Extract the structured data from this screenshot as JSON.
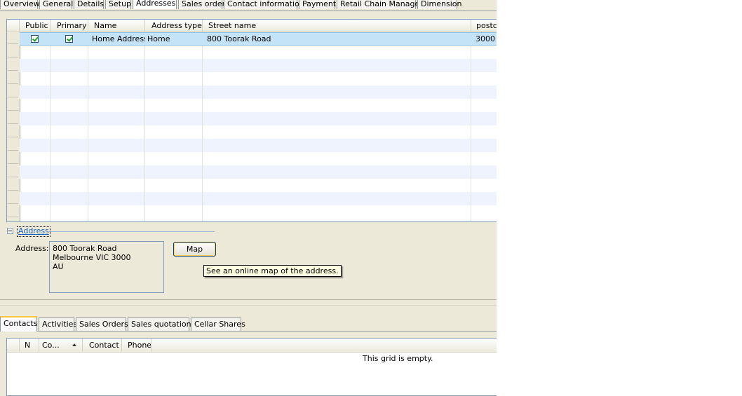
{
  "top_tabs": [
    {
      "label": "Overview"
    },
    {
      "label": "General"
    },
    {
      "label": "Details"
    },
    {
      "label": "Setup"
    },
    {
      "label": "Addresses"
    },
    {
      "label": "Sales order"
    },
    {
      "label": "Contact information"
    },
    {
      "label": "Payment"
    },
    {
      "label": "Retail Chain Manager"
    },
    {
      "label": "Dimension"
    }
  ],
  "active_top_tab": "Addresses",
  "address_grid": {
    "columns": [
      "Public",
      "Primary",
      "Name",
      "Address type",
      "Street name",
      "postcode"
    ],
    "rows": [
      {
        "public": true,
        "primary": true,
        "name": "Home Address",
        "address_type": "Home",
        "street_name": "800 Toorak Road",
        "postcode": "3000"
      }
    ]
  },
  "address_group": {
    "title": "Address",
    "address_label": "Address:",
    "address_lines": "800 Toorak Road\nMelbourne VIC 3000\nAU",
    "map_button": "Map",
    "map_tooltip": "See an online map of the address."
  },
  "bottom_tabs": [
    {
      "label": "Contacts"
    },
    {
      "label": "Activities"
    },
    {
      "label": "Sales Orders"
    },
    {
      "label": "Sales quotations"
    },
    {
      "label": "Cellar Shares"
    }
  ],
  "active_bottom_tab": "Contacts",
  "contacts_grid": {
    "columns": [
      "N",
      "Co...",
      "Contact",
      "Phone"
    ],
    "empty_text": "This grid is empty."
  },
  "colors": {
    "selected_row": "#c5e3f7",
    "tab_highlight": "#ffc83c",
    "window_bg": "#ece9d8"
  }
}
